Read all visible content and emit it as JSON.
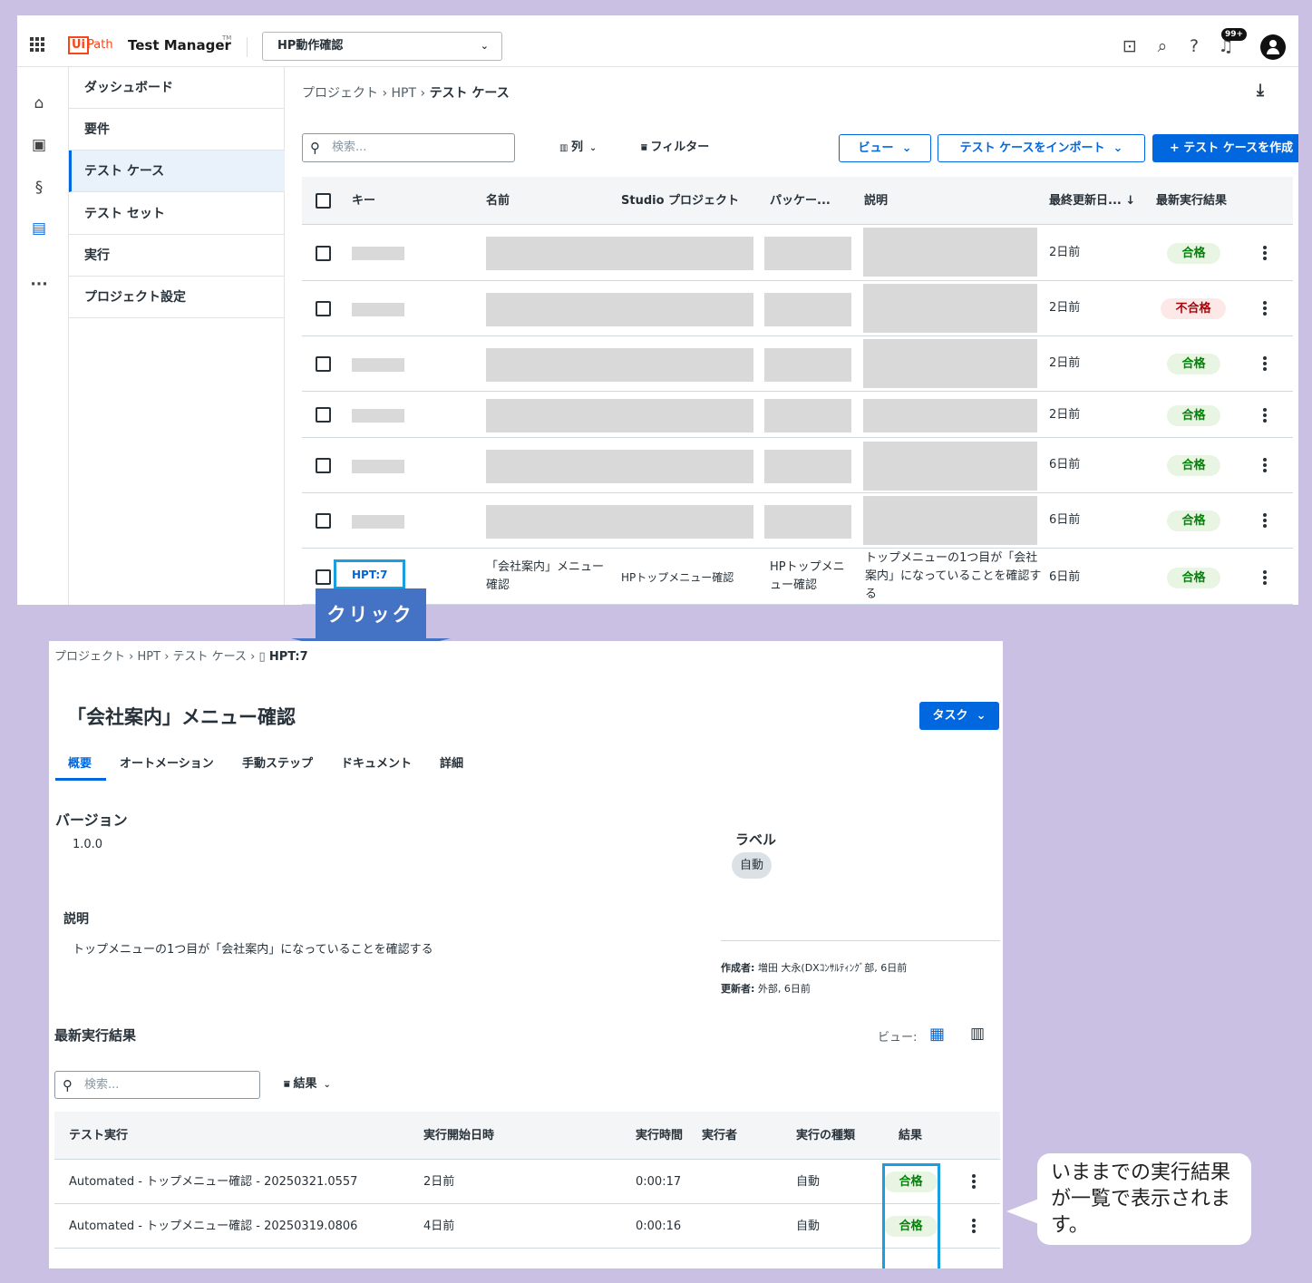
{
  "top": {
    "brand": {
      "logo_box": "Ui",
      "logo_text": "Path",
      "product": "Test Manager",
      "tm": "TM"
    },
    "project_select": "HP動作確認",
    "notification_badge": "99+",
    "nav": [
      {
        "label": "ダッシュボード"
      },
      {
        "label": "要件"
      },
      {
        "label": "テスト ケース"
      },
      {
        "label": "テスト セット"
      },
      {
        "label": "実行"
      },
      {
        "label": "プロジェクト設定"
      }
    ],
    "breadcrumb": {
      "a": "プロジェクト",
      "b": "HPT",
      "c": "テスト ケース"
    },
    "search_placeholder": "検索...",
    "columns_btn": "列",
    "filter_btn": "フィルター",
    "view_btn": "ビュー",
    "import_btn": "テスト ケースをインポート",
    "create_btn": "+ テスト ケースを作成",
    "table_headers": {
      "key": "キー",
      "name": "名前",
      "studio": "Studio プロジェクト",
      "package": "パッケー...",
      "desc": "説明",
      "updated": "最終更新日... ↓",
      "result": "最新実行結果"
    },
    "rows": [
      {
        "updated": "2日前",
        "result": "合格",
        "status": "pass"
      },
      {
        "updated": "2日前",
        "result": "不合格",
        "status": "fail"
      },
      {
        "updated": "2日前",
        "result": "合格",
        "status": "pass"
      },
      {
        "updated": "2日前",
        "result": "合格",
        "status": "pass"
      },
      {
        "updated": "6日前",
        "result": "合格",
        "status": "pass"
      },
      {
        "updated": "6日前",
        "result": "合格",
        "status": "pass"
      }
    ],
    "last_row": {
      "key": "HPT:7",
      "name": "「会社案内」メニュー確認",
      "studio": "HPトップメニュー確認",
      "package": "HPトップメニュー確認",
      "desc": "トップメニューの1つ目が「会社案内」になっていることを確認する",
      "updated": "6日前",
      "result": "合格"
    }
  },
  "callout": {
    "arrow_label": "クリック"
  },
  "detail": {
    "breadcrumb": {
      "a": "プロジェクト",
      "b": "HPT",
      "c": "テスト ケース",
      "d": "HPT:7"
    },
    "title": "「会社案内」メニュー確認",
    "task_btn": "タスク",
    "tabs": [
      "概要",
      "オートメーション",
      "手動ステップ",
      "ドキュメント",
      "詳細"
    ],
    "version_title": "バージョン",
    "version": "1.0.0",
    "label_title": "ラベル",
    "label_chip": "自動",
    "desc_title": "説明",
    "desc": "トップメニューの1つ目が「会社案内」になっていることを確認する",
    "created_label": "作成者:",
    "created_value": "増田 大永(DXｺﾝｻﾙﾃｨﾝｸﾞ部, 6日前",
    "updated_label": "更新者:",
    "updated_value": "外部, 6日前",
    "results_title": "最新実行結果",
    "view_label": "ビュー:",
    "search_placeholder": "検索...",
    "result_filter": "結果",
    "headers": {
      "run": "テスト実行",
      "start": "実行開始日時",
      "duration": "実行時間",
      "executor": "実行者",
      "type": "実行の種類",
      "result": "結果"
    },
    "runs": [
      {
        "name": "Automated - トップメニュー確認 - 20250321.0557",
        "start": "2日前",
        "duration": "0:00:17",
        "type": "自動",
        "result": "合格"
      },
      {
        "name": "Automated - トップメニュー確認 - 20250319.0806",
        "start": "4日前",
        "duration": "0:00:16",
        "type": "自動",
        "result": "合格"
      }
    ]
  },
  "bubble": {
    "text": "いままでの実行結果が一覧で表示されます。"
  },
  "colors": {
    "accent": "#0067df",
    "pass": "#038108",
    "fail": "#a6040a",
    "highlight": "#1b9ee0",
    "arrow": "#4472c4",
    "background": "#c9c0e4"
  }
}
